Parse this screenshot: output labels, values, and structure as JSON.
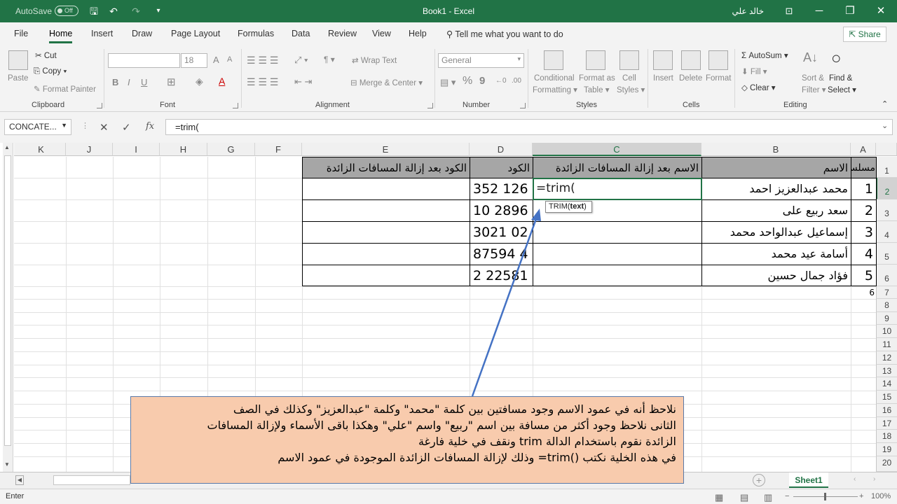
{
  "window": {
    "autosave_label": "AutoSave",
    "autosave_state": "Off",
    "title": "Book1  -  Excel",
    "user": "خالد علي",
    "min": "─",
    "restore": "❐",
    "close": "✕"
  },
  "tabs": [
    "File",
    "Home",
    "Insert",
    "Draw",
    "Page Layout",
    "Formulas",
    "Data",
    "Review",
    "View",
    "Help"
  ],
  "tellme": "Tell me what you want to do",
  "share": "Share",
  "ribbon": {
    "clipboard": {
      "label": "Clipboard",
      "paste": "Paste",
      "cut": "Cut",
      "copy": "Copy",
      "format_painter": "Format Painter"
    },
    "font": {
      "label": "Font",
      "size": "18",
      "grow": "A",
      "shrink": "A",
      "bold": "B",
      "italic": "I",
      "underline": "U"
    },
    "alignment": {
      "label": "Alignment",
      "wrap": "Wrap Text",
      "merge": "Merge & Center"
    },
    "number": {
      "label": "Number",
      "format": "General",
      "percent": "%",
      "comma": "9",
      "inc": "←0",
      "dec": ".00"
    },
    "styles": {
      "label": "Styles",
      "conditional": "Conditional",
      "formatting": "Formatting",
      "format_as": "Format as",
      "table": "Table",
      "cell": "Cell",
      "styles_btn": "Styles"
    },
    "cells": {
      "label": "Cells",
      "insert": "Insert",
      "delete": "Delete",
      "format": "Format"
    },
    "editing": {
      "label": "Editing",
      "autosum": "AutoSum",
      "fill": "Fill",
      "clear": "Clear",
      "sort": "Sort &",
      "filter": "Filter",
      "find": "Find &",
      "select": "Select"
    }
  },
  "formula_bar": {
    "name_box": "CONCATE...",
    "formula": "=trim("
  },
  "columns": [
    "K",
    "J",
    "I",
    "H",
    "G",
    "F",
    "E",
    "D",
    "C",
    "B",
    "A"
  ],
  "rows": [
    "1",
    "2",
    "3",
    "4",
    "5",
    "6",
    "7",
    "8",
    "9",
    "10",
    "11",
    "12",
    "13",
    "14",
    "15",
    "16",
    "17",
    "18",
    "19",
    "20"
  ],
  "headers": {
    "a": "مسلسل",
    "b": "الاسم",
    "c": "الاسم بعد إزالة المسافات الزائدة",
    "d": "الكود",
    "e": "الكود بعد إزالة المسافات الزائدة"
  },
  "data_rows": [
    {
      "a": "1",
      "b": "محمد عبدالعزيز  احمد",
      "d": "352 126"
    },
    {
      "a": "2",
      "b": "سعد ربيع   على",
      "d": "10 2896"
    },
    {
      "a": "3",
      "b": "إسماعيل  عبدالواحد   محمد",
      "d": "3021 02"
    },
    {
      "a": "4",
      "b": "أسامة عيد  محمد",
      "d": "87594 4"
    },
    {
      "a": "5",
      "b": "فؤاد جمال حسين",
      "d": "2 22581"
    }
  ],
  "a7_value": "6",
  "active_cell": "=trim(",
  "tooltip": {
    "fn": "TRIM(",
    "arg": "text",
    "close": ")"
  },
  "note": [
    "نلاحظ أنه في عمود الاسم وجود مسافتين بين كلمة \"محمد\" وكلمة \"عبدالعزيز\" وكذلك في الصف",
    "الثانى نلاحظ وجود أكثر من مسافة بين اسم \"ربيع\" واسم \"علي\" وهكذا باقى الأسماء ولإزالة المسافات",
    "الزائدة نقوم باستخدام الدالة trim ونقف في خلية فارغة",
    "في هذه الخلية نكتب ()trim= وذلك لإزالة المسافات الزائدة الموجودة في عمود الاسم"
  ],
  "sheet_tab": "Sheet1",
  "status": "Enter",
  "zoom": "100%"
}
